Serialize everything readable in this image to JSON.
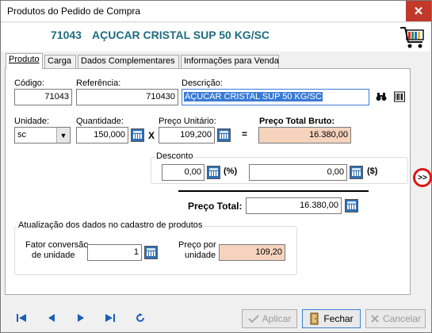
{
  "window": {
    "title": "Produtos do Pedido de Compra",
    "close_label": "✕"
  },
  "header": {
    "code": "71043",
    "name": "AÇUCAR CRISTAL SUP 50 KG/SC"
  },
  "tabs": [
    {
      "label": "Produto"
    },
    {
      "label": "Carga"
    },
    {
      "label": "Dados Complementares"
    },
    {
      "label": "Informações para Venda"
    }
  ],
  "form": {
    "codigo": {
      "label": "Código:",
      "value": "71043"
    },
    "referencia": {
      "label": "Referência:",
      "value": "710430"
    },
    "descricao": {
      "label": "Descrição:",
      "value": "AÇUCAR CRISTAL SUP 50 KG/SC"
    },
    "unidade": {
      "label": "Unidade:",
      "value": "sc"
    },
    "quantidade": {
      "label": "Quantidade:",
      "value": "150,000"
    },
    "preco_unitario": {
      "label": "Preço Unitário:",
      "value": "109,200"
    },
    "preco_total_bruto": {
      "label": "Preço Total Bruto:",
      "value": "16.380,00"
    },
    "multiply_sign": "X",
    "equals_sign": "=",
    "desconto": {
      "title": "Desconto",
      "percent_value": "0,00",
      "percent_unit": "(%)",
      "money_value": "0,00",
      "money_unit": "($)"
    },
    "preco_total": {
      "label": "Preço Total:",
      "value": "16.380,00"
    },
    "atualizacao": {
      "title": "Atualização dos dados no cadastro de produtos",
      "fator_label_1": "Fator conversão",
      "fator_label_2": "de unidade",
      "fator_value": "1",
      "preco_label_1": "Preço por",
      "preco_label_2": "unidade",
      "preco_value": "109,20"
    }
  },
  "side_button": {
    "label": ">>"
  },
  "nav": {
    "first_icon": "skip-first-icon",
    "prev_icon": "previous-icon",
    "next_icon": "next-icon",
    "last_icon": "skip-last-icon",
    "refresh_icon": "refresh-icon"
  },
  "buttons": {
    "aplicar": "Aplicar",
    "fechar": "Fechar",
    "cancelar": "Cancelar"
  },
  "colors": {
    "accent_text": "#1f6c80",
    "readonly_bg": "#f5d3bd",
    "selection": "#3a7bd5",
    "highlight_ring": "#e01414",
    "close_button": "#c0392b"
  }
}
